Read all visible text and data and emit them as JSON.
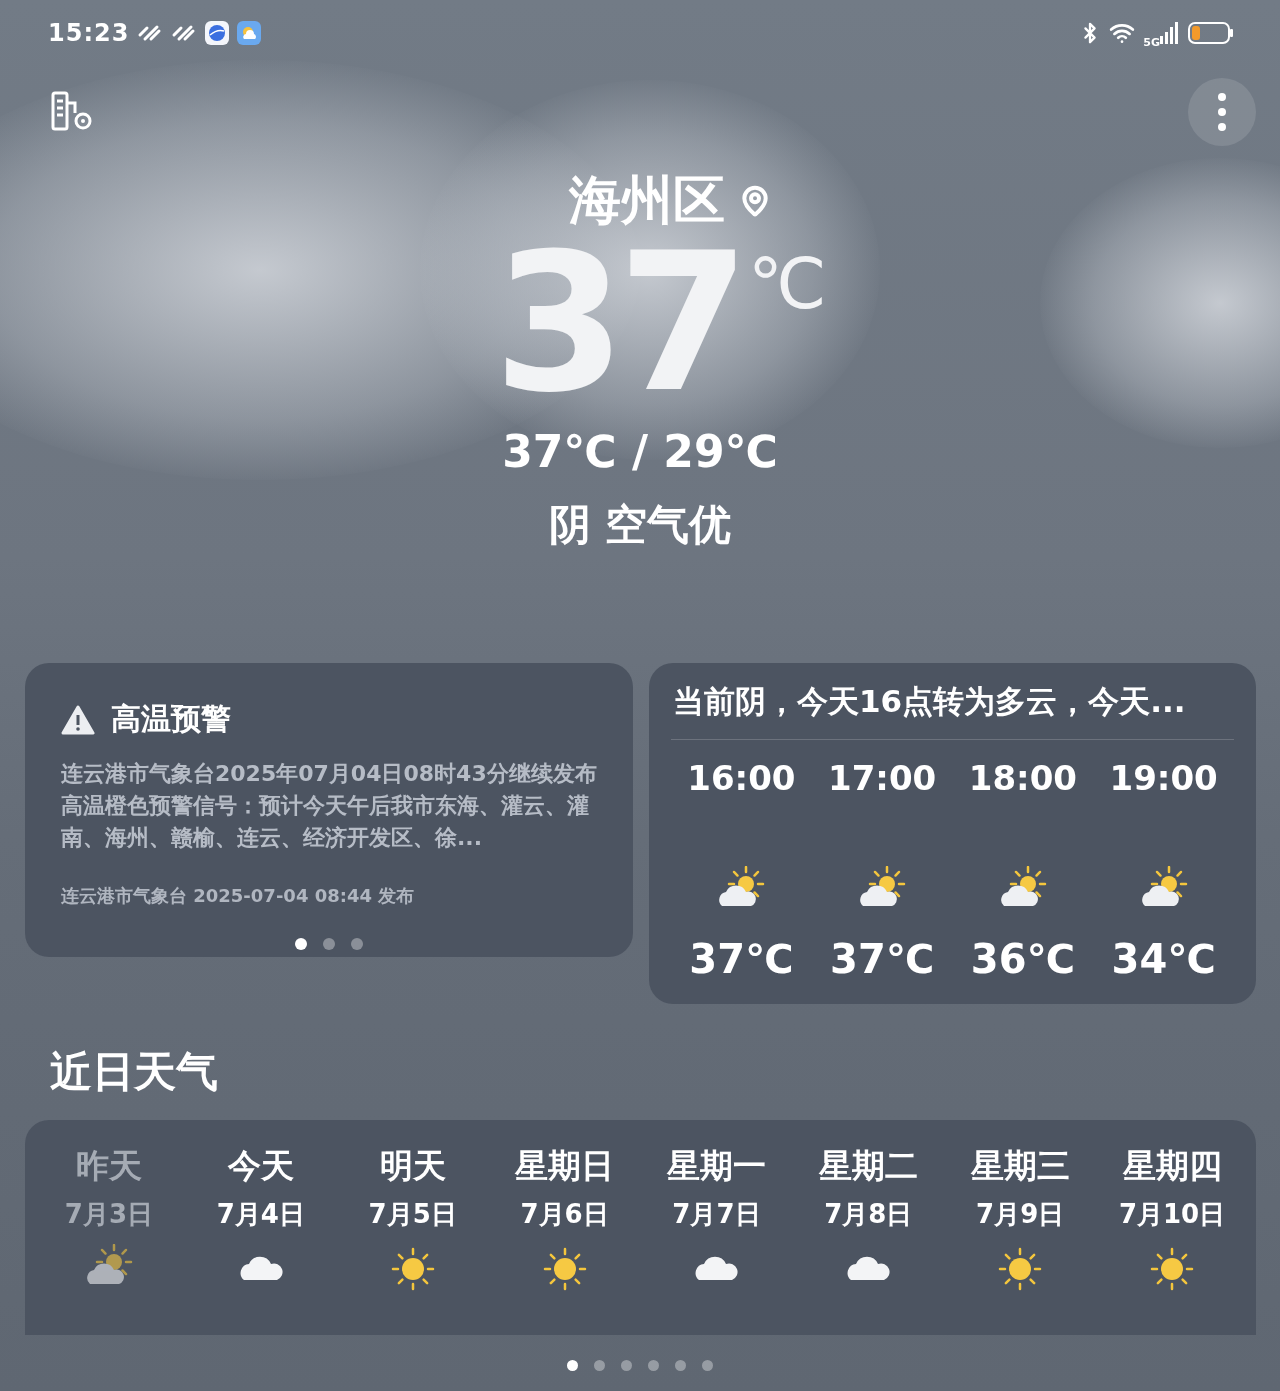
{
  "status_bar": {
    "time": "15:23",
    "network": "5G"
  },
  "location": {
    "name": "海州区"
  },
  "current": {
    "temperature": "37",
    "unit": "℃",
    "range": "37℃ / 29℃",
    "summary": "阴 空气优"
  },
  "warning": {
    "title": "高温预警",
    "body": "连云港市气象台2025年07月04日08时43分继续发布高温橙色预警信号：预计今天午后我市东海、灌云、灌南、海州、赣榆、连云、经济开发区、徐...",
    "source": "连云港市气象台 2025-07-04 08:44 发布",
    "pages": [
      {
        "selected": true
      },
      {
        "selected": false
      },
      {
        "selected": false
      }
    ]
  },
  "hourly": {
    "summary": "当前阴，今天16点转为多云，今天...",
    "hours": [
      {
        "time": "16:00",
        "kind": "partly_cloudy",
        "temp": "37℃"
      },
      {
        "time": "17:00",
        "kind": "partly_cloudy",
        "temp": "37℃"
      },
      {
        "time": "18:00",
        "kind": "partly_cloudy",
        "temp": "36℃"
      },
      {
        "time": "19:00",
        "kind": "partly_cloudy",
        "temp": "34℃"
      }
    ]
  },
  "daily": {
    "title": "近日天气",
    "days": [
      {
        "day": "昨天",
        "date": "7月3日",
        "kind": "partly_cloudy",
        "past": true
      },
      {
        "day": "今天",
        "date": "7月4日",
        "kind": "cloudy",
        "past": false
      },
      {
        "day": "明天",
        "date": "7月5日",
        "kind": "sunny",
        "past": false
      },
      {
        "day": "星期日",
        "date": "7月6日",
        "kind": "sunny",
        "past": false
      },
      {
        "day": "星期一",
        "date": "7月7日",
        "kind": "cloudy",
        "past": false
      },
      {
        "day": "星期二",
        "date": "7月8日",
        "kind": "cloudy",
        "past": false
      },
      {
        "day": "星期三",
        "date": "7月9日",
        "kind": "sunny",
        "past": false
      },
      {
        "day": "星期四",
        "date": "7月10日",
        "kind": "sunny",
        "past": false
      }
    ]
  },
  "page_indicator": [
    {
      "selected": true
    },
    {
      "selected": false
    },
    {
      "selected": false
    },
    {
      "selected": false
    },
    {
      "selected": false
    },
    {
      "selected": false
    }
  ]
}
